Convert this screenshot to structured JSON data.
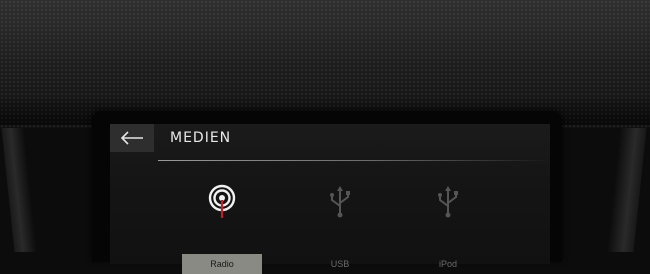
{
  "header": {
    "back_icon": "arrow-left-icon",
    "title": "MEDIEN"
  },
  "media_sources": [
    {
      "label": "Radio",
      "icon": "radio-signal-icon",
      "active": true
    },
    {
      "label": "USB",
      "icon": "usb-icon",
      "active": false
    },
    {
      "label": "iPod",
      "icon": "usb-icon",
      "active": false
    }
  ],
  "colors": {
    "accent": "#c0202a",
    "active_label_bg": "#8a8a84",
    "inactive_icon": "#555555"
  }
}
